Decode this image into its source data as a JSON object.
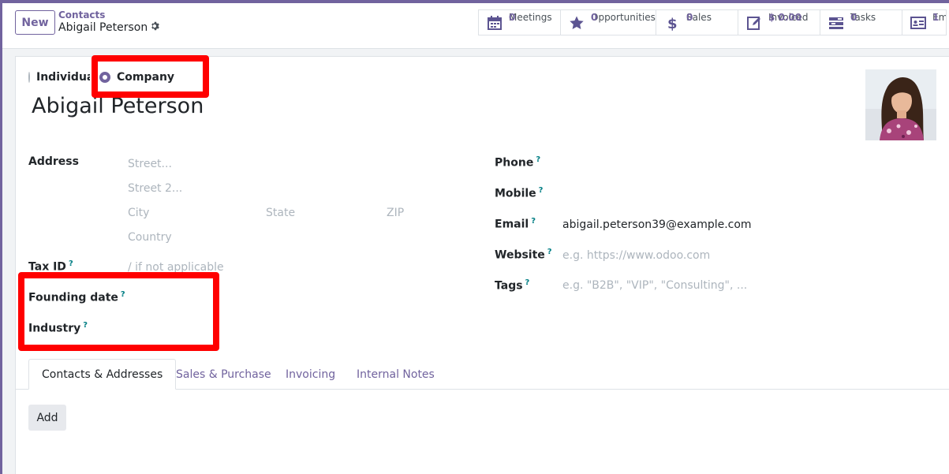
{
  "control_panel": {
    "new_label": "New",
    "breadcrumb_parent": "Contacts",
    "breadcrumb_current": "Abigail Peterson"
  },
  "smart_buttons": {
    "meetings": {
      "label": "Meetings",
      "value": "0",
      "icon": "calendar-icon"
    },
    "opportunities": {
      "label": "Opportunities",
      "value": "0",
      "icon": "star-icon"
    },
    "sales": {
      "label": "Sales",
      "value": "0",
      "icon": "dollar-icon"
    },
    "invoiced": {
      "label": "Invoiced",
      "value": "$ 0.00",
      "icon": "invoice-icon"
    },
    "tasks": {
      "label": "Tasks",
      "value": "0",
      "icon": "tasks-icon"
    },
    "employees": {
      "label": "Emp",
      "value": "1",
      "icon": "id-card-icon"
    }
  },
  "form": {
    "company_type": {
      "individual_label": "Individual",
      "company_label": "Company",
      "selected": "Company"
    },
    "name": "Abigail Peterson",
    "left": {
      "address_label": "Address",
      "street_placeholder": "Street...",
      "street2_placeholder": "Street 2...",
      "city_placeholder": "City",
      "state_placeholder": "State",
      "zip_placeholder": "ZIP",
      "country_placeholder": "Country",
      "taxid_label": "Tax ID",
      "taxid_placeholder": "/ if not applicable",
      "founding_label": "Founding date",
      "industry_label": "Industry"
    },
    "right": {
      "phone_label": "Phone",
      "mobile_label": "Mobile",
      "email_label": "Email",
      "email_value": "abigail.peterson39@example.com",
      "website_label": "Website",
      "website_placeholder": "e.g. https://www.odoo.com",
      "tags_label": "Tags",
      "tags_placeholder": "e.g. \"B2B\", \"VIP\", \"Consulting\", ..."
    },
    "help_marker": "?"
  },
  "tabs": [
    {
      "label": "Contacts & Addresses",
      "active": true
    },
    {
      "label": "Sales & Purchase",
      "active": false
    },
    {
      "label": "Invoicing",
      "active": false
    },
    {
      "label": "Internal Notes",
      "active": false
    }
  ],
  "add_label": "Add",
  "colors": {
    "brand": "#71639e",
    "highlight": "#ff0000",
    "help": "#017e84"
  }
}
